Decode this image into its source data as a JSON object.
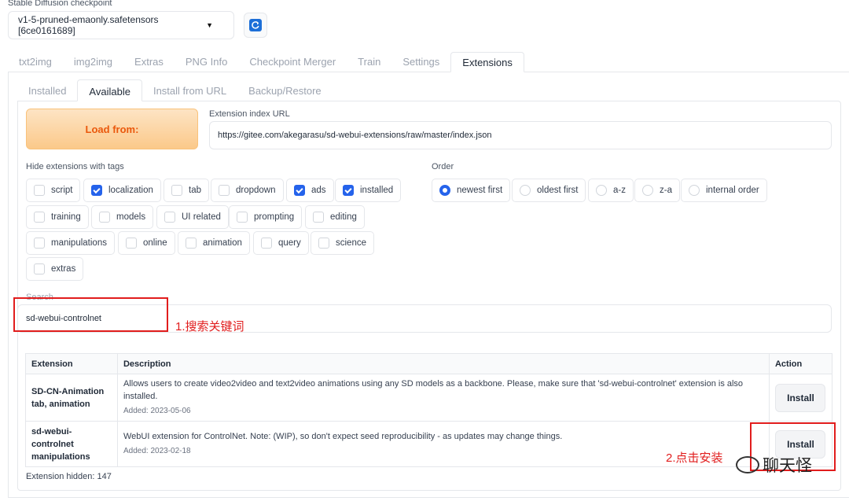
{
  "checkpoint": {
    "label": "Stable Diffusion checkpoint",
    "value": "v1-5-pruned-emaonly.safetensors [6ce0161689]",
    "refresh_icon": "refresh-icon"
  },
  "main_tabs": [
    "txt2img",
    "img2img",
    "Extras",
    "PNG Info",
    "Checkpoint Merger",
    "Train",
    "Settings",
    "Extensions"
  ],
  "main_tab_active": "Extensions",
  "sub_tabs": [
    "Installed",
    "Available",
    "Install from URL",
    "Backup/Restore"
  ],
  "sub_tab_active": "Available",
  "load_button": "Load from:",
  "index_url": {
    "label": "Extension index URL",
    "value": "https://gitee.com/akegarasu/sd-webui-extensions/raw/master/index.json"
  },
  "hide_tags": {
    "label": "Hide extensions with tags",
    "rows": [
      [
        {
          "label": "script",
          "checked": false
        },
        {
          "label": "localization",
          "checked": true
        },
        {
          "label": "tab",
          "checked": false
        },
        {
          "label": "dropdown",
          "checked": false
        },
        {
          "label": "ads",
          "checked": true
        },
        {
          "label": "installed",
          "checked": true
        }
      ],
      [
        {
          "label": "training",
          "checked": false
        },
        {
          "label": "models",
          "checked": false
        },
        {
          "label": "UI related",
          "checked": false
        },
        {
          "label": "prompting",
          "checked": false
        },
        {
          "label": "editing",
          "checked": false
        }
      ],
      [
        {
          "label": "manipulations",
          "checked": false
        },
        {
          "label": "online",
          "checked": false
        },
        {
          "label": "animation",
          "checked": false
        },
        {
          "label": "query",
          "checked": false
        },
        {
          "label": "science",
          "checked": false
        }
      ],
      [
        {
          "label": "extras",
          "checked": false
        }
      ]
    ]
  },
  "order": {
    "label": "Order",
    "options": [
      "newest first",
      "oldest first",
      "a-z",
      "z-a",
      "internal order"
    ],
    "selected": "newest first"
  },
  "search": {
    "label": "Search",
    "value": "sd-webui-controlnet"
  },
  "annotations": {
    "step1": "1.搜索关键词",
    "step2": "2.点击安装"
  },
  "table": {
    "headers": [
      "Extension",
      "Description",
      "Action"
    ],
    "rows": [
      {
        "name": "SD-CN-Animation",
        "tags": "tab, animation",
        "description": "Allows users to create video2video and text2video animations using any SD models as a backbone. Please, make sure that 'sd-webui-controlnet' extension is also installed.",
        "added": "Added: 2023-05-06",
        "action": "Install"
      },
      {
        "name": "sd-webui-controlnet",
        "tags": "manipulations",
        "description": "WebUI extension for ControlNet. Note: (WIP), so don't expect seed reproducibility - as updates may change things.",
        "added": "Added: 2023-02-18",
        "action": "Install"
      }
    ]
  },
  "hidden_count": "Extension hidden: 147",
  "watermark": "聊天怪",
  "colors": {
    "accent": "#2563eb",
    "load_button_text": "#ea580c",
    "annotation": "#e11d1d"
  }
}
